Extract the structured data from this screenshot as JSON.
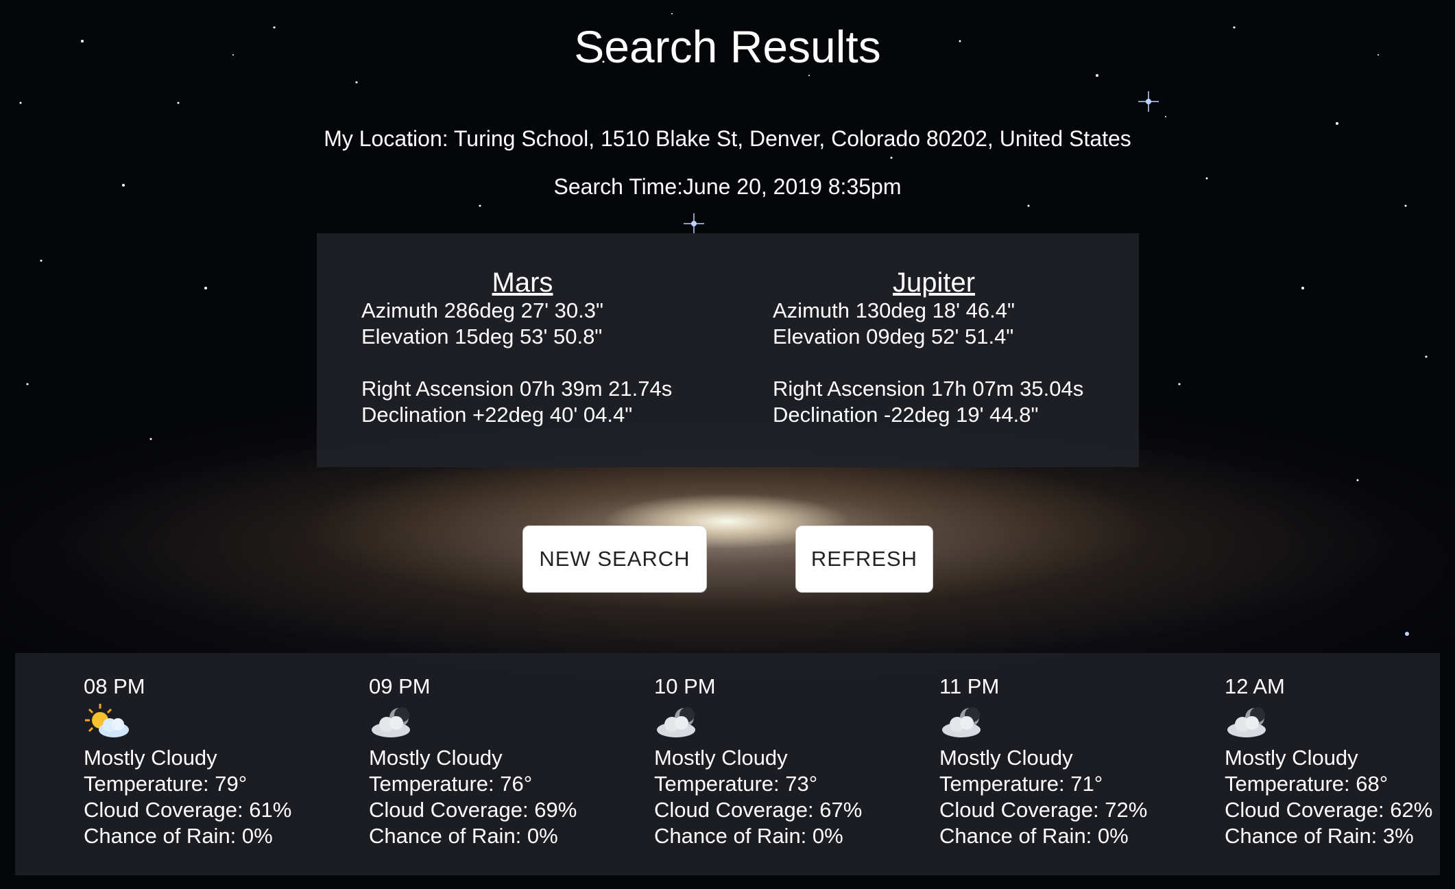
{
  "page": {
    "title": "Search Results",
    "location": "My Location: Turing School, 1510 Blake St, Denver, Colorado 80202, United States",
    "search_time": "Search Time:June 20, 2019 8:35pm"
  },
  "planets": [
    {
      "name": "Mars",
      "azimuth": "Azimuth 286deg 27' 30.3\"",
      "elevation": "Elevation 15deg 53' 50.8\"",
      "right_ascension": "Right Ascension 07h 39m 21.74s",
      "declination": "Declination +22deg 40' 04.4\""
    },
    {
      "name": "Jupiter",
      "azimuth": "Azimuth 130deg 18' 46.4\"",
      "elevation": "Elevation 09deg 52' 51.4\"",
      "right_ascension": "Right Ascension 17h 07m 35.04s",
      "declination": "Declination -22deg 19' 44.8\""
    }
  ],
  "buttons": {
    "new_search": "NEW SEARCH",
    "refresh": "REFRESH"
  },
  "forecast": [
    {
      "time": "08 PM",
      "icon": "partly-sunny-icon",
      "summary": "Mostly Cloudy",
      "temperature": "Temperature: 79°",
      "cloud_coverage": "Cloud Coverage: 61%",
      "rain": "Chance of Rain: 0%"
    },
    {
      "time": "09 PM",
      "icon": "cloudy-night-icon",
      "summary": "Mostly Cloudy",
      "temperature": "Temperature: 76°",
      "cloud_coverage": "Cloud Coverage: 69%",
      "rain": "Chance of Rain: 0%"
    },
    {
      "time": "10 PM",
      "icon": "cloudy-night-icon",
      "summary": "Mostly Cloudy",
      "temperature": "Temperature: 73°",
      "cloud_coverage": "Cloud Coverage: 67%",
      "rain": "Chance of Rain: 0%"
    },
    {
      "time": "11 PM",
      "icon": "cloudy-night-icon",
      "summary": "Mostly Cloudy",
      "temperature": "Temperature: 71°",
      "cloud_coverage": "Cloud Coverage: 72%",
      "rain": "Chance of Rain: 0%"
    },
    {
      "time": "12 AM",
      "icon": "cloudy-night-icon",
      "summary": "Mostly Cloudy",
      "temperature": "Temperature: 68°",
      "cloud_coverage": "Cloud Coverage: 62%",
      "rain": "Chance of Rain: 3%"
    }
  ]
}
